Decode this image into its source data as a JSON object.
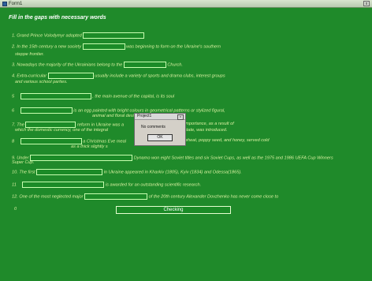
{
  "window": {
    "title": "Form1",
    "close_label": "x"
  },
  "header": "Fill in the gaps with necessary  words",
  "sentences": [
    {
      "num": "1",
      "before": "Grand Prince Volodymyr adopted",
      "after": ""
    },
    {
      "num": "2",
      "before": "In the 15th century a new society",
      "after": "was beginning to form on the Ukraine's southern",
      "wrap": "steppe frontier."
    },
    {
      "num": "3",
      "before": "Nowadays the majority of the Ukrainians belong to the",
      "after": "Church."
    },
    {
      "num": "4",
      "before": "Extra-curricular",
      "after": "usually include a variety of sports and drama clubs, interest groups",
      "wrap": "and various school parties."
    },
    {
      "num": "5",
      "before": "",
      "after": ", the main avenue of the capital, is its soul"
    },
    {
      "num": "6",
      "before": "",
      "after": "is an egg painted with bright colours in geometrical patterns or stylized figural,",
      "wrap": "animal and floral designs."
    },
    {
      "num": "7",
      "before": "The",
      "after": "reform in Ukraine was a",
      "after2": "importance, as a result of",
      "wrap": "which the domestic currency, one of the integral",
      "wrap2": "state, was introduced."
    },
    {
      "num": "8",
      "before": "",
      "after": "a Christmas Eve meal",
      "after2": "wheat, poppy seed, and honey, served cold",
      "wrap": "as a thick slightly s"
    },
    {
      "num": "9",
      "before": "Under",
      "after": "Dynamo won eight Soviet titles and six Soviet Cups, as well as the 1975 and 1986 UEFA Cup Winners",
      "wrap": "Super Cup."
    },
    {
      "num": "10",
      "before": "The first",
      "after": "in Ukraine appeared in Kharkiv (1805), Kyiv (1834) and Odessa(1865)."
    },
    {
      "num": "11",
      "before": "",
      "after": "is awarded for an outstanding scientific research."
    },
    {
      "num": "12",
      "before": "One of the most neglected major",
      "after": "of the 20th century Alexander Dovzhenko has never come close to"
    }
  ],
  "score_label": "0",
  "check_button": "Checking",
  "dialog": {
    "title": "Project1",
    "message": "No comments",
    "ok": "OK"
  }
}
